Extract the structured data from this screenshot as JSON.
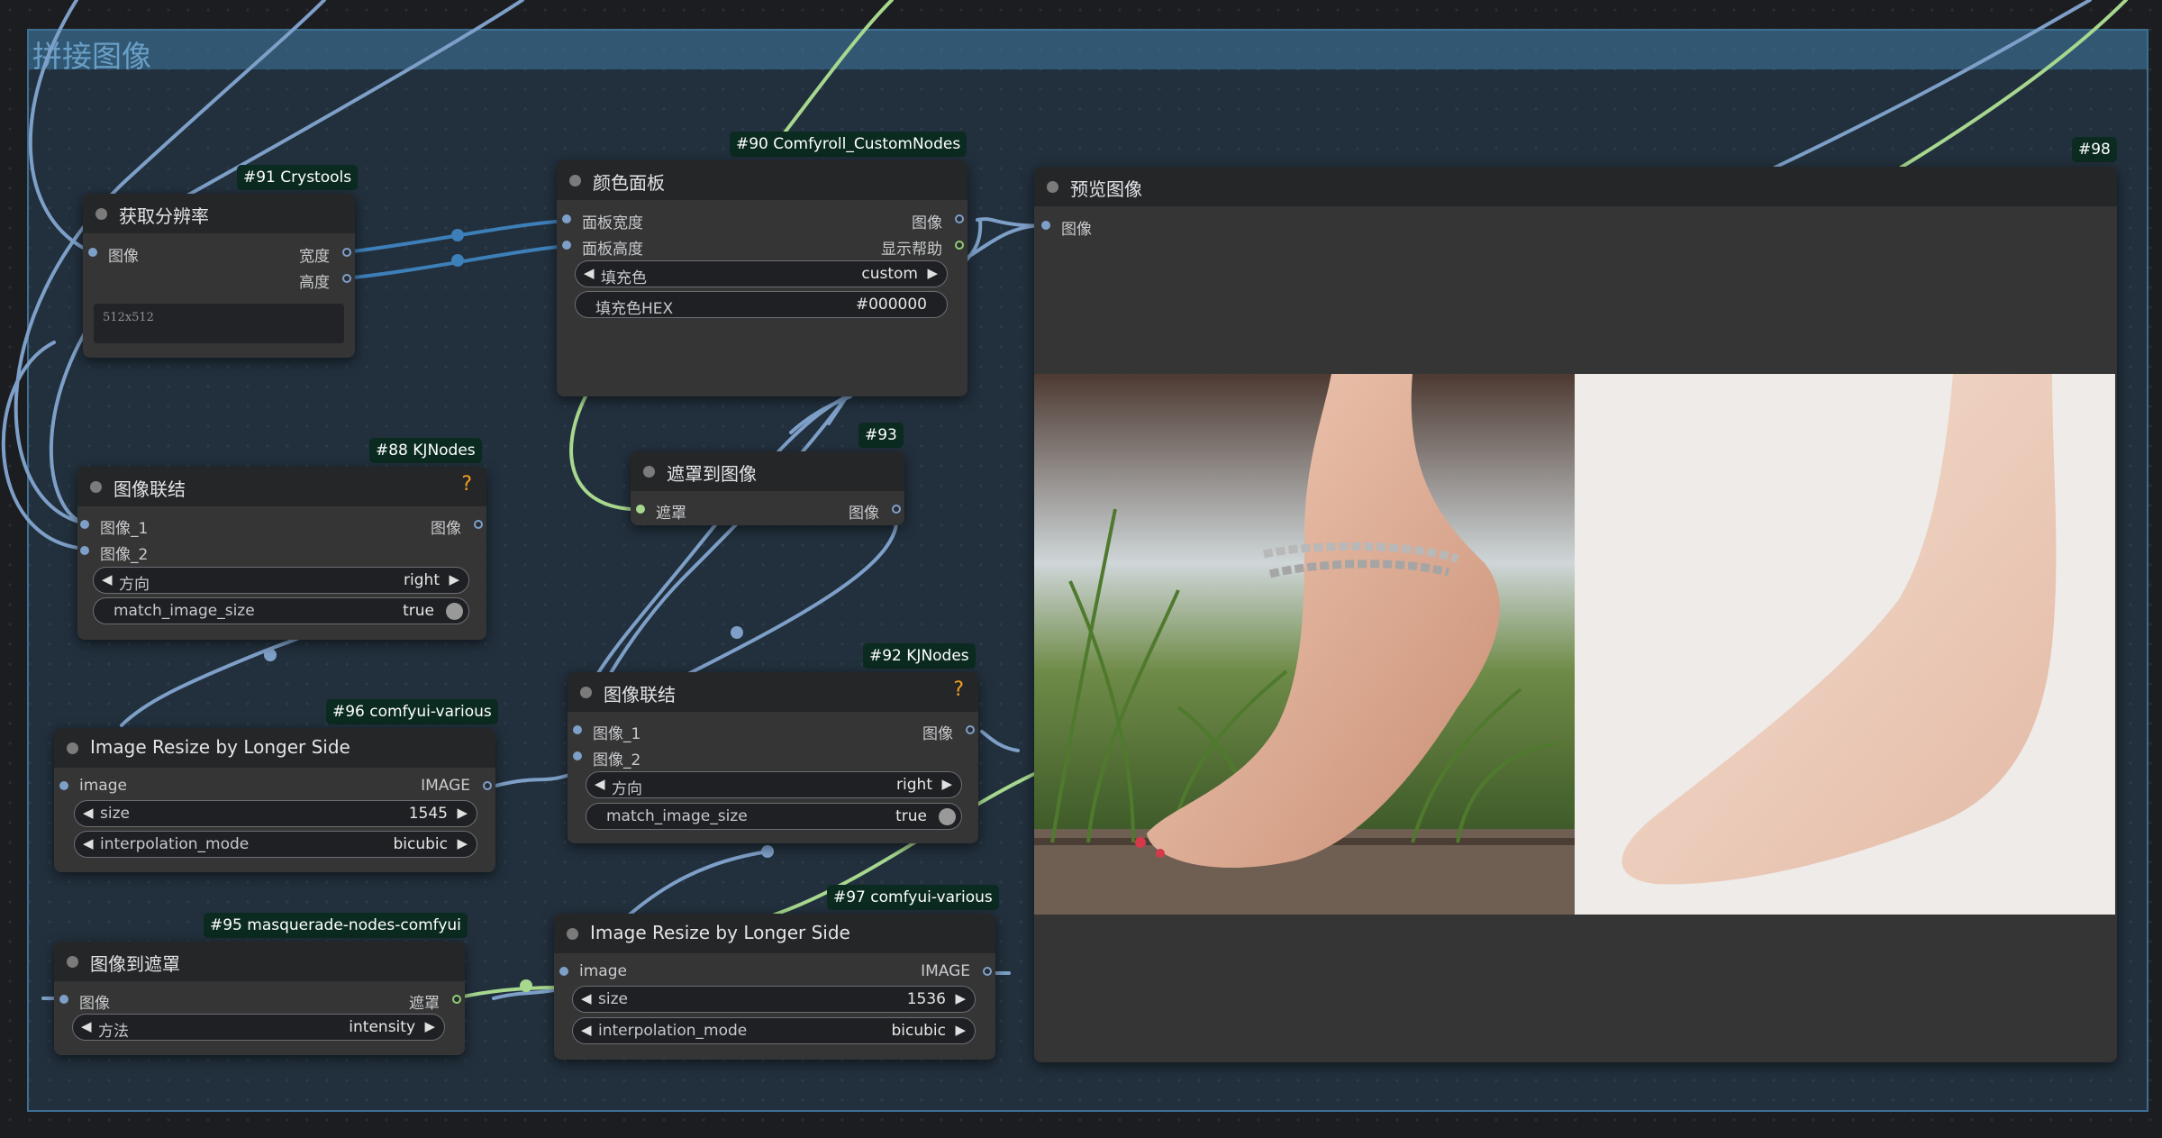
{
  "group": {
    "title": "拼接图像"
  },
  "nodes": {
    "n91": {
      "badge": "#91 Crystools",
      "title": "获取分辨率",
      "inputs": [
        "图像"
      ],
      "outputs": [
        "宽度",
        "高度"
      ],
      "text": "512x512"
    },
    "n90": {
      "badge": "#90 Comfyroll_CustomNodes",
      "title": "颜色面板",
      "inputs": [
        "面板宽度",
        "面板高度"
      ],
      "outputs": [
        "图像",
        "显示帮助"
      ],
      "widgets": [
        {
          "label": "填充色",
          "value": "custom"
        },
        {
          "label": "填充色HEX",
          "value": "#000000"
        }
      ]
    },
    "n98": {
      "badge": "#98",
      "title": "预览图像",
      "inputs": [
        "图像"
      ]
    },
    "n88": {
      "badge": "#88 KJNodes",
      "title": "图像联结",
      "help": "?",
      "inputs": [
        "图像_1",
        "图像_2"
      ],
      "outputs": [
        "图像"
      ],
      "widgets": [
        {
          "label": "方向",
          "value": "right"
        },
        {
          "label": "match_image_size",
          "value": "true"
        }
      ]
    },
    "n93": {
      "badge": "#93",
      "title": "遮罩到图像",
      "inputs": [
        "遮罩"
      ],
      "outputs": [
        "图像"
      ]
    },
    "n92": {
      "badge": "#92 KJNodes",
      "title": "图像联结",
      "help": "?",
      "inputs": [
        "图像_1",
        "图像_2"
      ],
      "outputs": [
        "图像"
      ],
      "widgets": [
        {
          "label": "方向",
          "value": "right"
        },
        {
          "label": "match_image_size",
          "value": "true"
        }
      ]
    },
    "n96": {
      "badge": "#96 comfyui-various",
      "title": "Image Resize by Longer Side",
      "inputs": [
        "image"
      ],
      "outputs": [
        "IMAGE"
      ],
      "widgets": [
        {
          "label": "size",
          "value": "1545"
        },
        {
          "label": "interpolation_mode",
          "value": "bicubic"
        }
      ]
    },
    "n95": {
      "badge": "#95 masquerade-nodes-comfyui",
      "title": "图像到遮罩",
      "inputs": [
        "图像"
      ],
      "outputs": [
        "遮罩"
      ],
      "widgets": [
        {
          "label": "方法",
          "value": "intensity"
        }
      ]
    },
    "n97": {
      "badge": "#97 comfyui-various",
      "title": "Image Resize by Longer Side",
      "inputs": [
        "image"
      ],
      "outputs": [
        "IMAGE"
      ],
      "widgets": [
        {
          "label": "size",
          "value": "1536"
        },
        {
          "label": "interpolation_mode",
          "value": "bicubic"
        }
      ]
    }
  },
  "colors": {
    "canvas": "#1c1d21",
    "node_body": "#353535",
    "node_title": "#252628",
    "link_image": "#7ea0c8",
    "link_mask": "#a7d88e",
    "link_int": "#3d7fb8",
    "badge_bg": "#0b2b20",
    "help_icon": "#f0a020"
  },
  "icons": {
    "arrow_left": "◀",
    "arrow_right": "▶",
    "node_status": "status-dot-icon"
  }
}
